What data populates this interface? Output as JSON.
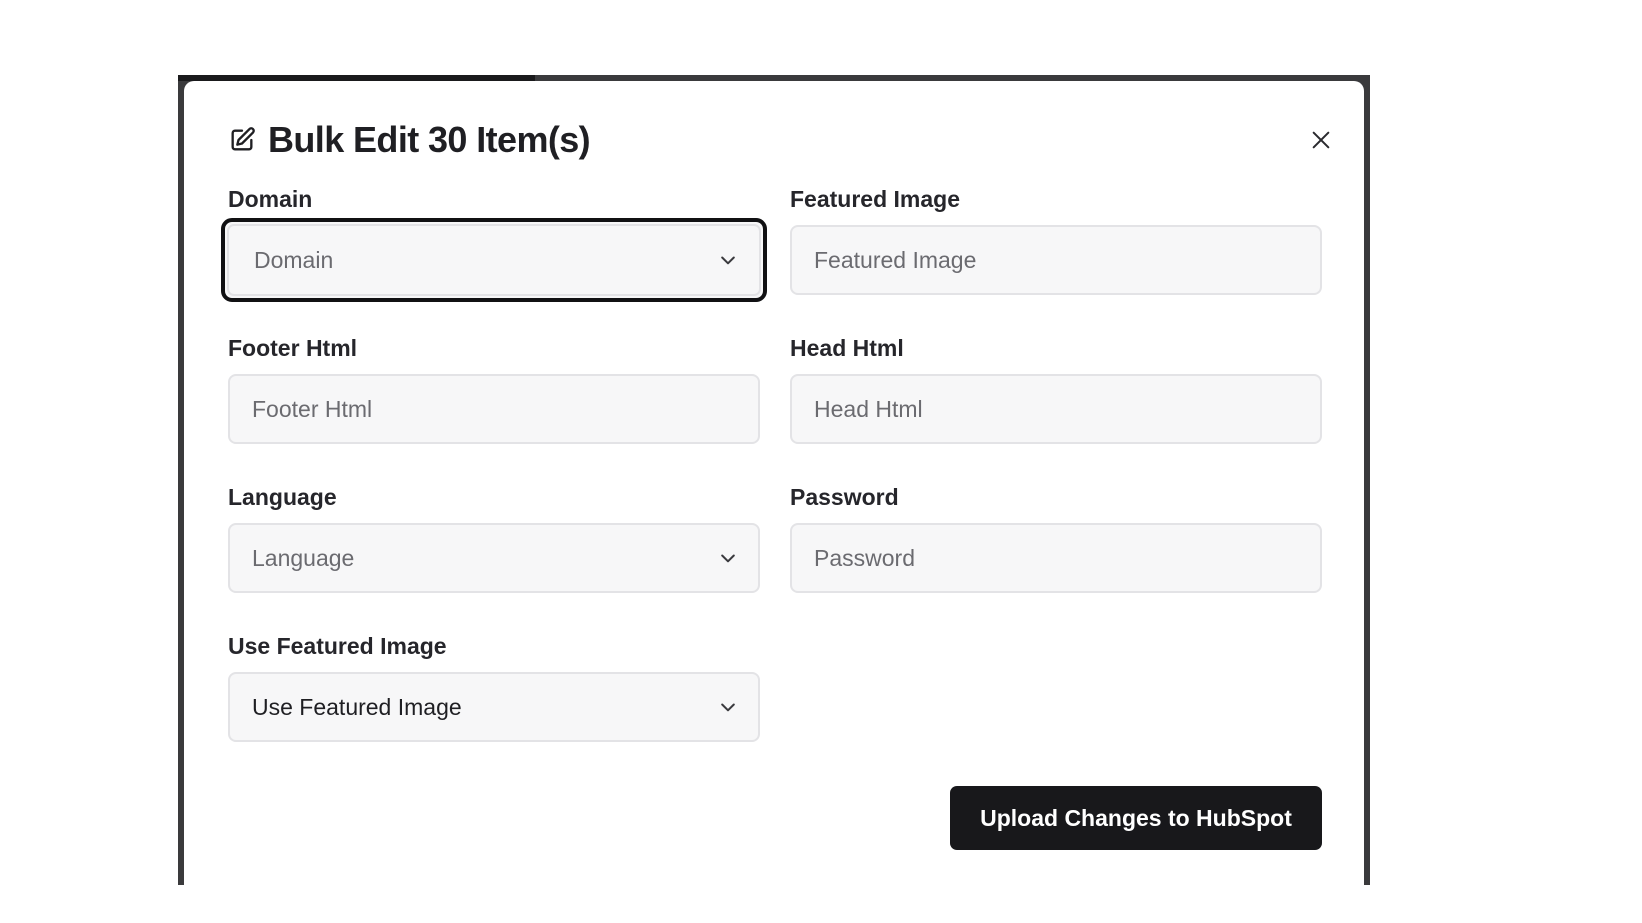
{
  "modal": {
    "title": "Bulk Edit 30 Item(s)",
    "title_icon": "edit-icon",
    "close_icon": "close-icon"
  },
  "fields": {
    "domain": {
      "label": "Domain",
      "type": "select",
      "value": "Domain",
      "focused": true
    },
    "featured_image": {
      "label": "Featured Image",
      "type": "text",
      "placeholder": "Featured Image",
      "value": ""
    },
    "footer_html": {
      "label": "Footer Html",
      "type": "text",
      "placeholder": "Footer Html",
      "value": ""
    },
    "head_html": {
      "label": "Head Html",
      "type": "text",
      "placeholder": "Head Html",
      "value": ""
    },
    "language": {
      "label": "Language",
      "type": "select",
      "value": "Language"
    },
    "password": {
      "label": "Password",
      "type": "password",
      "placeholder": "Password",
      "value": ""
    },
    "use_featured_image": {
      "label": "Use Featured Image",
      "type": "select",
      "value": "Use Featured Image"
    }
  },
  "actions": {
    "upload_label": "Upload Changes to HubSpot"
  },
  "colors": {
    "backdrop": "#3a3a3c",
    "modal_bg": "#ffffff",
    "input_bg": "#f7f7f8",
    "input_border": "#e3e3e6",
    "focus_ring": "#111113",
    "primary_button": "#18181b",
    "text_strong": "#1f1f23",
    "text_placeholder": "#6b6b70"
  }
}
